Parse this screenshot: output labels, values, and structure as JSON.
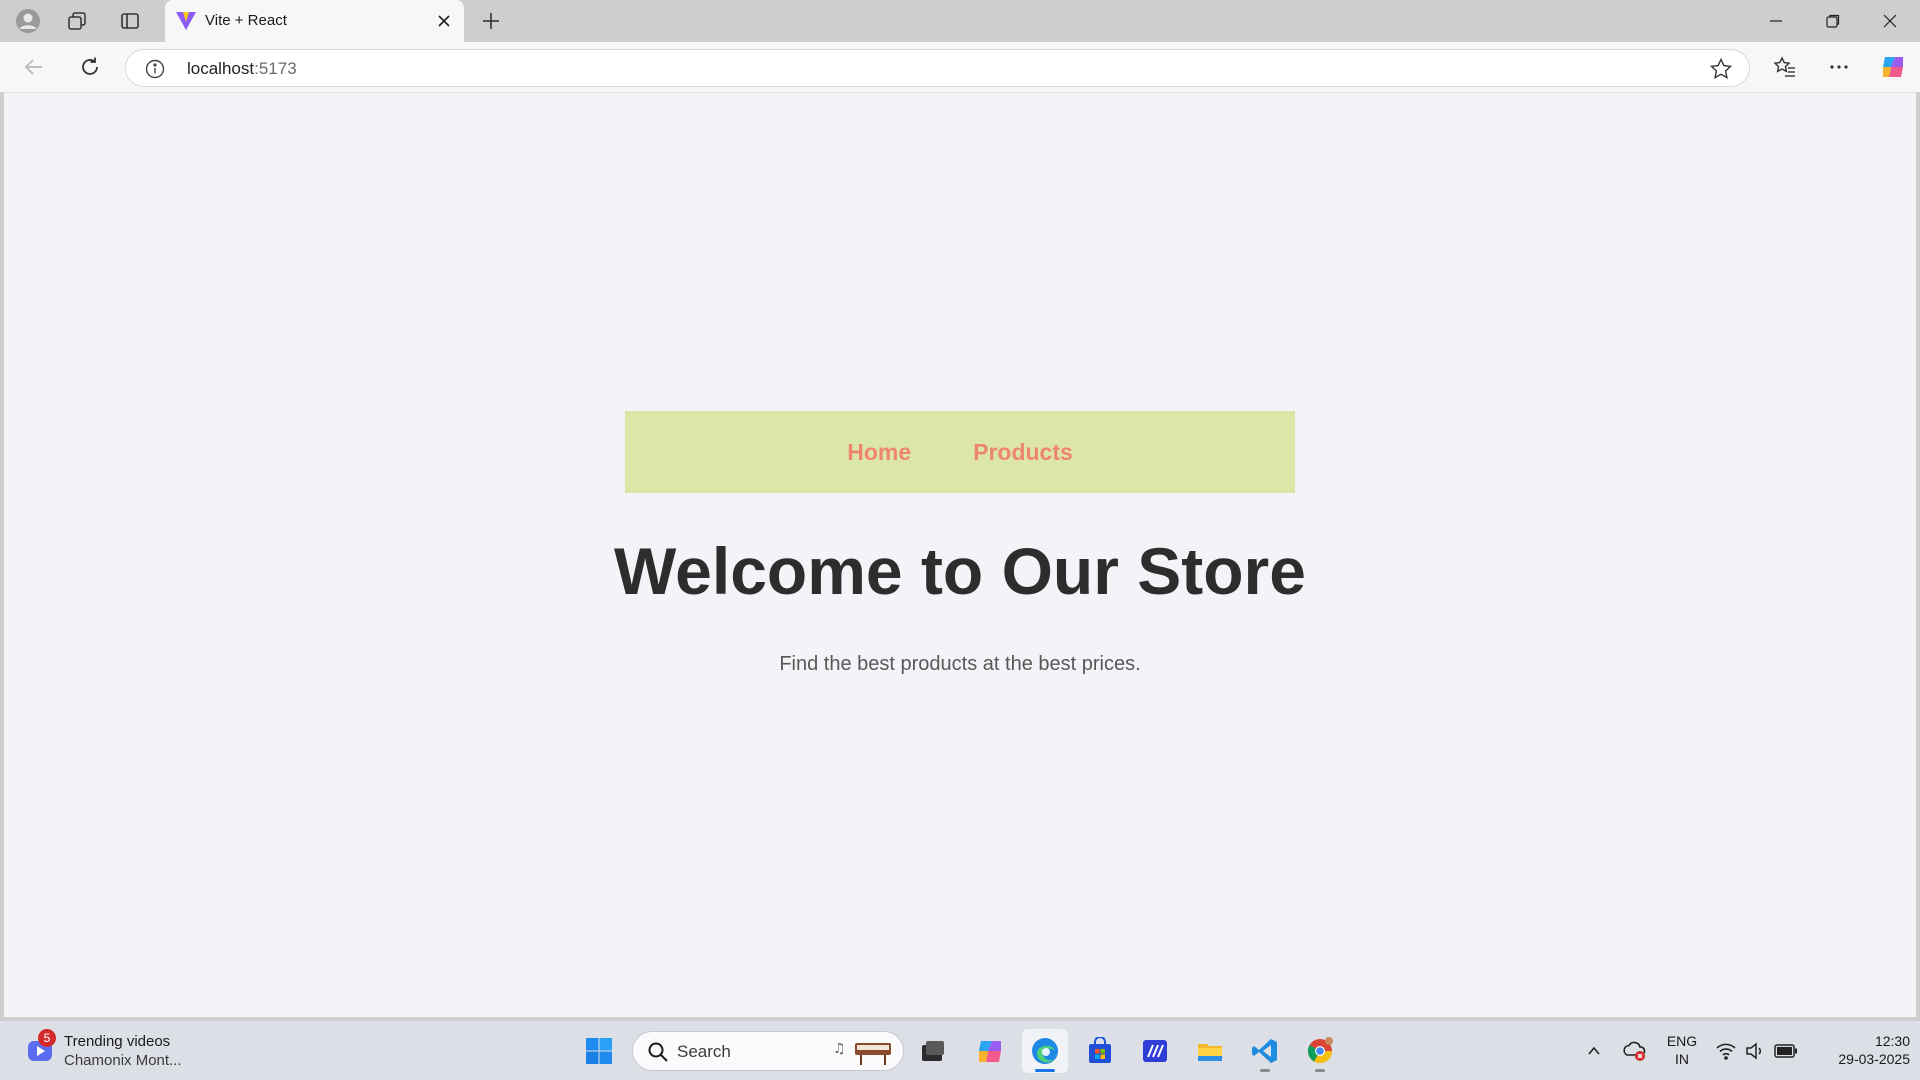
{
  "browser": {
    "tab_title": "Vite + React",
    "url_host": "localhost",
    "url_port": ":5173"
  },
  "page": {
    "nav_links": [
      "Home",
      "Products"
    ],
    "heading": "Welcome to Our Store",
    "subheading": "Find the best products at the best prices."
  },
  "colors": {
    "navbar_bg": "#dde6a9",
    "nav_link": "#ed8572",
    "page_bg": "#f3f4f7",
    "heading": "#2d2d2d"
  },
  "taskbar": {
    "widget_badge": "5",
    "widget_title": "Trending videos",
    "widget_subtitle": "Chamonix Mont...",
    "search_label": "Search",
    "lang_line1": "ENG",
    "lang_line2": "IN",
    "time": "12:30",
    "date": "29-03-2025",
    "apps": [
      "start-icon",
      "task-view-icon",
      "copilot-icon",
      "edge-icon",
      "store-icon",
      "terminal-icon",
      "file-explorer-icon",
      "vscode-icon",
      "chrome-icon"
    ]
  }
}
